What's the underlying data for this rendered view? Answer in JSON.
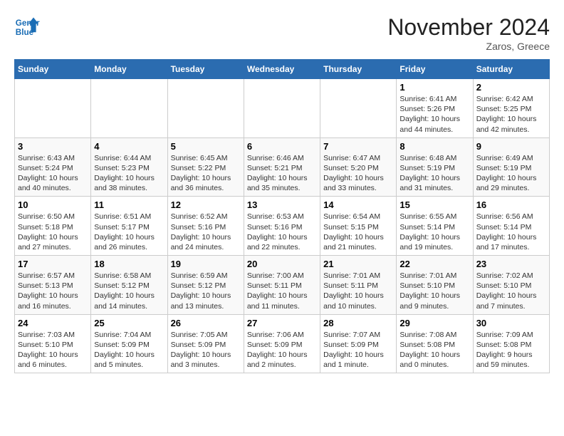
{
  "header": {
    "logo_line1": "General",
    "logo_line2": "Blue",
    "month": "November 2024",
    "location": "Zaros, Greece"
  },
  "weekdays": [
    "Sunday",
    "Monday",
    "Tuesday",
    "Wednesday",
    "Thursday",
    "Friday",
    "Saturday"
  ],
  "weeks": [
    [
      {
        "day": "",
        "info": ""
      },
      {
        "day": "",
        "info": ""
      },
      {
        "day": "",
        "info": ""
      },
      {
        "day": "",
        "info": ""
      },
      {
        "day": "",
        "info": ""
      },
      {
        "day": "1",
        "info": "Sunrise: 6:41 AM\nSunset: 5:26 PM\nDaylight: 10 hours\nand 44 minutes."
      },
      {
        "day": "2",
        "info": "Sunrise: 6:42 AM\nSunset: 5:25 PM\nDaylight: 10 hours\nand 42 minutes."
      }
    ],
    [
      {
        "day": "3",
        "info": "Sunrise: 6:43 AM\nSunset: 5:24 PM\nDaylight: 10 hours\nand 40 minutes."
      },
      {
        "day": "4",
        "info": "Sunrise: 6:44 AM\nSunset: 5:23 PM\nDaylight: 10 hours\nand 38 minutes."
      },
      {
        "day": "5",
        "info": "Sunrise: 6:45 AM\nSunset: 5:22 PM\nDaylight: 10 hours\nand 36 minutes."
      },
      {
        "day": "6",
        "info": "Sunrise: 6:46 AM\nSunset: 5:21 PM\nDaylight: 10 hours\nand 35 minutes."
      },
      {
        "day": "7",
        "info": "Sunrise: 6:47 AM\nSunset: 5:20 PM\nDaylight: 10 hours\nand 33 minutes."
      },
      {
        "day": "8",
        "info": "Sunrise: 6:48 AM\nSunset: 5:19 PM\nDaylight: 10 hours\nand 31 minutes."
      },
      {
        "day": "9",
        "info": "Sunrise: 6:49 AM\nSunset: 5:19 PM\nDaylight: 10 hours\nand 29 minutes."
      }
    ],
    [
      {
        "day": "10",
        "info": "Sunrise: 6:50 AM\nSunset: 5:18 PM\nDaylight: 10 hours\nand 27 minutes."
      },
      {
        "day": "11",
        "info": "Sunrise: 6:51 AM\nSunset: 5:17 PM\nDaylight: 10 hours\nand 26 minutes."
      },
      {
        "day": "12",
        "info": "Sunrise: 6:52 AM\nSunset: 5:16 PM\nDaylight: 10 hours\nand 24 minutes."
      },
      {
        "day": "13",
        "info": "Sunrise: 6:53 AM\nSunset: 5:16 PM\nDaylight: 10 hours\nand 22 minutes."
      },
      {
        "day": "14",
        "info": "Sunrise: 6:54 AM\nSunset: 5:15 PM\nDaylight: 10 hours\nand 21 minutes."
      },
      {
        "day": "15",
        "info": "Sunrise: 6:55 AM\nSunset: 5:14 PM\nDaylight: 10 hours\nand 19 minutes."
      },
      {
        "day": "16",
        "info": "Sunrise: 6:56 AM\nSunset: 5:14 PM\nDaylight: 10 hours\nand 17 minutes."
      }
    ],
    [
      {
        "day": "17",
        "info": "Sunrise: 6:57 AM\nSunset: 5:13 PM\nDaylight: 10 hours\nand 16 minutes."
      },
      {
        "day": "18",
        "info": "Sunrise: 6:58 AM\nSunset: 5:12 PM\nDaylight: 10 hours\nand 14 minutes."
      },
      {
        "day": "19",
        "info": "Sunrise: 6:59 AM\nSunset: 5:12 PM\nDaylight: 10 hours\nand 13 minutes."
      },
      {
        "day": "20",
        "info": "Sunrise: 7:00 AM\nSunset: 5:11 PM\nDaylight: 10 hours\nand 11 minutes."
      },
      {
        "day": "21",
        "info": "Sunrise: 7:01 AM\nSunset: 5:11 PM\nDaylight: 10 hours\nand 10 minutes."
      },
      {
        "day": "22",
        "info": "Sunrise: 7:01 AM\nSunset: 5:10 PM\nDaylight: 10 hours\nand 9 minutes."
      },
      {
        "day": "23",
        "info": "Sunrise: 7:02 AM\nSunset: 5:10 PM\nDaylight: 10 hours\nand 7 minutes."
      }
    ],
    [
      {
        "day": "24",
        "info": "Sunrise: 7:03 AM\nSunset: 5:10 PM\nDaylight: 10 hours\nand 6 minutes."
      },
      {
        "day": "25",
        "info": "Sunrise: 7:04 AM\nSunset: 5:09 PM\nDaylight: 10 hours\nand 5 minutes."
      },
      {
        "day": "26",
        "info": "Sunrise: 7:05 AM\nSunset: 5:09 PM\nDaylight: 10 hours\nand 3 minutes."
      },
      {
        "day": "27",
        "info": "Sunrise: 7:06 AM\nSunset: 5:09 PM\nDaylight: 10 hours\nand 2 minutes."
      },
      {
        "day": "28",
        "info": "Sunrise: 7:07 AM\nSunset: 5:09 PM\nDaylight: 10 hours\nand 1 minute."
      },
      {
        "day": "29",
        "info": "Sunrise: 7:08 AM\nSunset: 5:08 PM\nDaylight: 10 hours\nand 0 minutes."
      },
      {
        "day": "30",
        "info": "Sunrise: 7:09 AM\nSunset: 5:08 PM\nDaylight: 9 hours\nand 59 minutes."
      }
    ]
  ]
}
